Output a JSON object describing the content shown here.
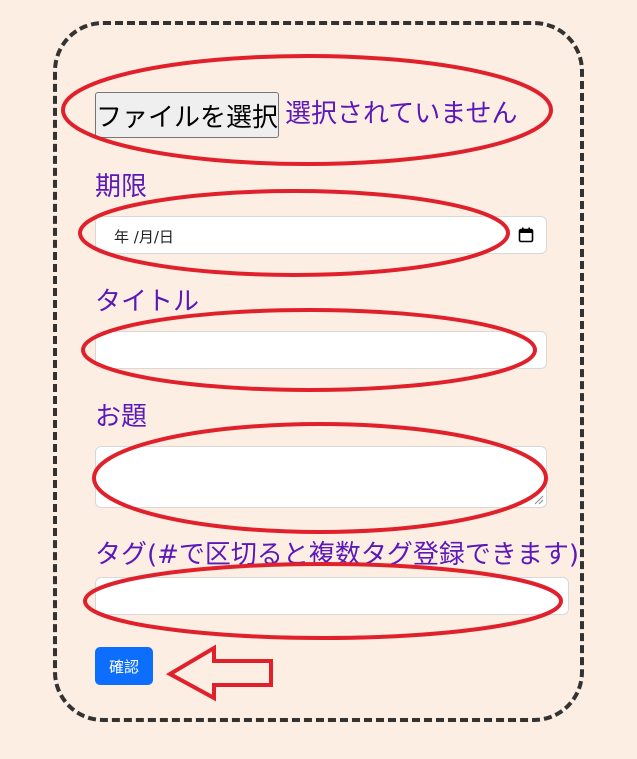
{
  "file_input": {
    "button_label": "ファイルを選択",
    "status": "選択されていません"
  },
  "deadline": {
    "label": "期限",
    "placeholder": "年 /月/日"
  },
  "title": {
    "label": "タイトル",
    "value": ""
  },
  "topic": {
    "label": "お題",
    "value": ""
  },
  "tags": {
    "label": "タグ(#で区切ると複数タグ登録できます)",
    "value": ""
  },
  "confirm_button": {
    "label": "確認"
  },
  "icons": {
    "date_picker": "calendar-icon",
    "arrow": "left-arrow-icon"
  },
  "colors": {
    "background": "#fdeee4",
    "label_text": "#5b19b8",
    "primary_button": "#0d6efd",
    "annotation": "#e0212b",
    "frame": "#333333"
  }
}
